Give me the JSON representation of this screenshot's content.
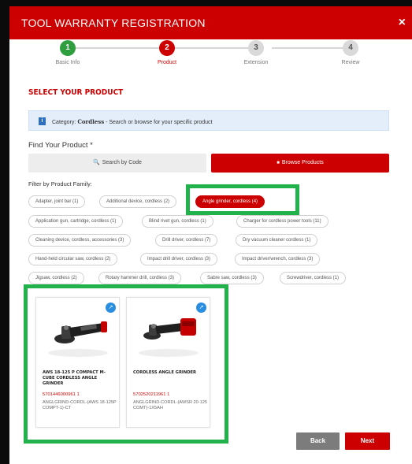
{
  "header": {
    "title": "TOOL WARRANTY REGISTRATION",
    "close": "×"
  },
  "steps": [
    {
      "num": "1",
      "label": "Basic Info",
      "state": "done"
    },
    {
      "num": "2",
      "label": "Product",
      "state": "active"
    },
    {
      "num": "3",
      "label": "Extension",
      "state": "todo"
    },
    {
      "num": "4",
      "label": "Review",
      "state": "todo"
    }
  ],
  "section_title": "SELECT YOUR PRODUCT",
  "info": {
    "icon": "i",
    "prefix": "Category:",
    "category": "Cordless",
    "suffix": " - Search or browse for your specific product"
  },
  "find": {
    "label": "Find Your Product *",
    "search_icon": "🔍",
    "search_label": "Search by Code",
    "browse_icon": "■",
    "browse_label": "Browse Products"
  },
  "filter": {
    "label": "Filter by Product Family:",
    "chips": [
      "Adapter, joint bar (1)",
      "Additional device, cordless (2)",
      "Angle grinder, cordless (4)",
      "Application gun, cartridge, cordless (1)",
      "Blind rivet gun, cordless (1)",
      "Charger for cordless power tools (11)",
      "Cleaning device, cordless, accessories (3)",
      "Drill driver, cordless (7)",
      "Dry vacuum cleaner cordless (1)",
      "Hand-held circular saw, cordless (2)",
      "Impact drill driver, cordless (3)",
      "Impact driver/wrench, cordless (3)",
      "Jigsaw, cordless (2)",
      "Rotary hammer drill, cordless (3)",
      "Sabre saw, cordless (3)",
      "Screwdriver, cordless (1)"
    ],
    "selected": "Angle grinder, cordless (4)"
  },
  "products": [
    {
      "name": "AWS 18-125 P COMPACT M-CUBE CORDLESS ANGLE GRINDER",
      "code": "5701446000961 1",
      "desc": "ANGLGRIND-CORDL-(AWS 18-125P COMPT-1)-CT",
      "link_icon": "↗"
    },
    {
      "name": "CORDLESS ANGLE GRINDER",
      "code": "5702520211961 1",
      "desc": "ANGLGRIND-CORDL-(AWSR 20-125 COMT)-1X5AH",
      "link_icon": "↗"
    }
  ],
  "actions": {
    "back": "Back",
    "next": "Next"
  },
  "colors": {
    "brand": "#cc0000",
    "done": "#2e9e3e",
    "highlight": "#22b24c",
    "info_bg": "#e3eefa",
    "link": "#2a8ee0"
  }
}
